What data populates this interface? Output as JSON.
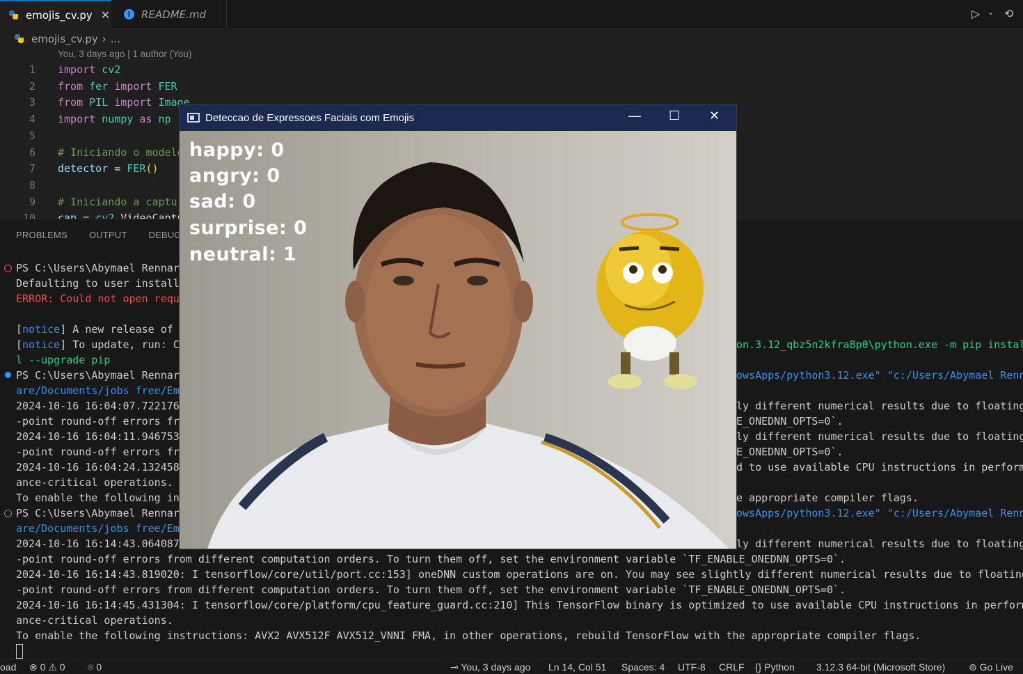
{
  "tabs": [
    {
      "label": "emojis_cv.py"
    },
    {
      "label": "README.md"
    }
  ],
  "breadcrumb": {
    "file": "emojis_cv.py",
    "rest": "..."
  },
  "blame": "You, 3 days ago | 1 author (You)",
  "code": {
    "line_numbers": [
      "1",
      "2",
      "3",
      "4",
      "5",
      "6",
      "7",
      "8",
      "9",
      "10"
    ],
    "lines": [
      [
        {
          "t": "import",
          "c": "kw"
        },
        {
          "t": " cv2",
          "c": "mod"
        }
      ],
      [
        {
          "t": "from",
          "c": "kw"
        },
        {
          "t": " fer ",
          "c": "mod"
        },
        {
          "t": "import",
          "c": "kw"
        },
        {
          "t": " FER",
          "c": "mod"
        }
      ],
      [
        {
          "t": "from",
          "c": "kw"
        },
        {
          "t": " PIL ",
          "c": "mod"
        },
        {
          "t": "import",
          "c": "kw"
        },
        {
          "t": " Image",
          "c": "mod"
        }
      ],
      [
        {
          "t": "import",
          "c": "kw"
        },
        {
          "t": " numpy ",
          "c": "mod"
        },
        {
          "t": "as",
          "c": "kw"
        },
        {
          "t": " np",
          "c": "mod"
        }
      ],
      [],
      [
        {
          "t": "# Iniciando o modelo",
          "c": "cmt"
        }
      ],
      [
        {
          "t": "detector",
          "c": "var"
        },
        {
          "t": " = ",
          "c": "op"
        },
        {
          "t": "FER",
          "c": "mod"
        },
        {
          "t": "()",
          "c": "br"
        }
      ],
      [],
      [
        {
          "t": "# Iniciando a captura",
          "c": "cmt"
        }
      ],
      [
        {
          "t": "cap",
          "c": "var"
        },
        {
          "t": " = ",
          "c": "op"
        },
        {
          "t": "cv2",
          "c": "mod"
        },
        {
          "t": ".VideoCapture",
          "c": "op"
        }
      ]
    ]
  },
  "panel_tabs": [
    "PROBLEMS",
    "OUTPUT",
    "DEBUG C"
  ],
  "terminal_left": [
    {
      "t": "PS C:\\Users\\Abymael Rennar",
      "c": "",
      "deco": "err"
    },
    {
      "t": "Defaulting to user install",
      "c": ""
    },
    {
      "t": "ERROR: Could not open requ",
      "c": "err"
    },
    {
      "t": "",
      "c": ""
    },
    {
      "t": "[notice] A new release of ",
      "c": "notice"
    },
    {
      "t": "[notice] To update, run: C",
      "c": "notice"
    },
    {
      "t": "l --upgrade pip",
      "c": "green"
    },
    {
      "t": "PS C:\\Users\\Abymael Rennar",
      "c": "",
      "deco": "ok"
    },
    {
      "t": "are/Documents/jobs free/Em",
      "c": "link"
    },
    {
      "t": "2024-10-16 16:04:07.722176",
      "c": ""
    },
    {
      "t": "-point round-off errors fr",
      "c": ""
    },
    {
      "t": "2024-10-16 16:04:11.946753",
      "c": ""
    },
    {
      "t": "-point round-off errors fr",
      "c": ""
    },
    {
      "t": "2024-10-16 16:04:24.132458",
      "c": ""
    },
    {
      "t": "ance-critical operations.",
      "c": ""
    },
    {
      "t": "To enable the following in",
      "c": ""
    },
    {
      "t": "PS C:\\Users\\Abymael Rennar",
      "c": "",
      "deco": "empty"
    },
    {
      "t": "are/Documents/jobs free/Em",
      "c": "link"
    },
    {
      "t": "2024-10-16 16:14:43.064087",
      "c": ""
    },
    {
      "t": "-point round-off errors from different computation orders. To turn them off, set the environment variable `TF_ENABLE_ONEDNN_OPTS=0`.",
      "c": ""
    },
    {
      "t": "2024-10-16 16:14:43.819020: I tensorflow/core/util/port.cc:153] oneDNN custom operations are on. You may see slightly different numerical results due to floating",
      "c": ""
    },
    {
      "t": "-point round-off errors from different computation orders. To turn them off, set the environment variable `TF_ENABLE_ONEDNN_OPTS=0`.",
      "c": ""
    },
    {
      "t": "2024-10-16 16:14:45.431304: I tensorflow/core/platform/cpu_feature_guard.cc:210] This TensorFlow binary is optimized to use available CPU instructions in perform",
      "c": ""
    },
    {
      "t": "ance-critical operations.",
      "c": ""
    },
    {
      "t": "To enable the following instructions: AVX2 AVX512F AVX512_VNNI FMA, in other operations, rebuild TensorFlow with the appropriate compiler flags.",
      "c": ""
    }
  ],
  "terminal_right": [
    {
      "row": 5,
      "t": "on.3.12_qbz5n2kfra8p0\\python.exe -m pip instal",
      "c": "green"
    },
    {
      "row": 7,
      "t": "owsApps/python3.12.exe\" \"c:/Users/Abymael Renn",
      "c": "link"
    },
    {
      "row": 9,
      "t": "ly different numerical results due to floating",
      "c": ""
    },
    {
      "row": 10,
      "t": "E_ONEDNN_OPTS=0`.",
      "c": ""
    },
    {
      "row": 11,
      "t": "ly different numerical results due to floating",
      "c": ""
    },
    {
      "row": 12,
      "t": "E_ONEDNN_OPTS=0`.",
      "c": ""
    },
    {
      "row": 13,
      "t": "d to use available CPU instructions in perform",
      "c": ""
    },
    {
      "row": 15,
      "t": "e appropriate compiler flags.",
      "c": ""
    },
    {
      "row": 16,
      "t": "owsApps/python3.12.exe\" \"c:/Users/Abymael Renn",
      "c": "link"
    },
    {
      "row": 18,
      "t": "ly different numerical results due to floating",
      "c": ""
    }
  ],
  "statusbar": {
    "left_cut": "oad",
    "errors": "0",
    "warnings": "0",
    "ports": "0",
    "blame": "You, 3 days ago",
    "position": "Ln 14, Col 51",
    "spaces": "Spaces: 4",
    "encoding": "UTF-8",
    "eol": "CRLF",
    "language": "Python",
    "interpreter": "3.12.3 64-bit (Microsoft Store)",
    "golive": "Go Live"
  },
  "cv_window": {
    "title": "Deteccao de Expressoes Faciais com Emojis",
    "emotions": [
      {
        "label": "happy: 0"
      },
      {
        "label": "angry: 0"
      },
      {
        "label": "sad: 0"
      },
      {
        "label": "surprise: 0"
      },
      {
        "label": "neutral: 1"
      }
    ]
  },
  "colors": {
    "accent": "#0078d4",
    "titlebar": "#1c2a52",
    "error": "#f14c4c",
    "notice": "#3b8eea",
    "success": "#23d18b"
  }
}
